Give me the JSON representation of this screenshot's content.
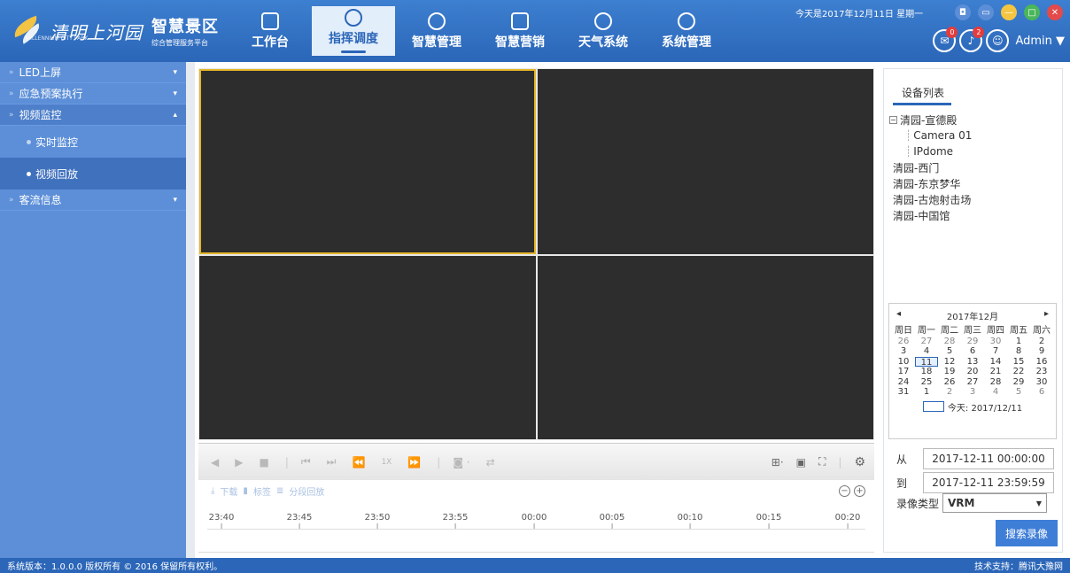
{
  "header": {
    "logo_script": "清明上河园",
    "logo_title": "智慧景区",
    "logo_subtitle": "综合管理服务平台",
    "logo_en": "MILLENNIUM CITY PARK",
    "date_line": "今天是2017年12月11日 星期一",
    "nav": [
      {
        "label": "工作台"
      },
      {
        "label": "指挥调度"
      },
      {
        "label": "智慧管理"
      },
      {
        "label": "智慧营销"
      },
      {
        "label": "天气系统"
      },
      {
        "label": "系统管理"
      }
    ],
    "badge_msg": "0",
    "badge_alert": "2",
    "username": "Admin ▼"
  },
  "sidebar": {
    "items": [
      {
        "label": "LED上屏"
      },
      {
        "label": "应急预案执行"
      },
      {
        "label": "视频监控"
      },
      {
        "label": "客流信息"
      }
    ],
    "sub": [
      {
        "label": "实时监控"
      },
      {
        "label": "视频回放"
      }
    ]
  },
  "controls": {
    "speed": "1X",
    "tool_download": "下载",
    "tool_bookmark": "标签",
    "tool_segment": "分段回放"
  },
  "timeline": {
    "ticks": [
      "23:40",
      "23:45",
      "23:50",
      "23:55",
      "00:00",
      "00:05",
      "00:10",
      "00:15",
      "00:20"
    ]
  },
  "right": {
    "tab": "设备列表",
    "tree_root": "清园-宣德殿",
    "tree_children": [
      "Camera 01",
      "IPdome"
    ],
    "tree_leaves": [
      "清园-西门",
      "清园-东京梦华",
      "清园-古炮射击场",
      "清园-中国馆"
    ],
    "calendar": {
      "title": "2017年12月",
      "weekdays": [
        "周日",
        "周一",
        "周二",
        "周三",
        "周四",
        "周五",
        "周六"
      ],
      "days": [
        "26",
        "27",
        "28",
        "29",
        "30",
        "1",
        "2",
        "3",
        "4",
        "5",
        "6",
        "7",
        "8",
        "9",
        "10",
        "11",
        "12",
        "13",
        "14",
        "15",
        "16",
        "17",
        "18",
        "19",
        "20",
        "21",
        "22",
        "23",
        "24",
        "25",
        "26",
        "27",
        "28",
        "29",
        "30",
        "31",
        "1",
        "2",
        "3",
        "4",
        "5",
        "6"
      ],
      "today": "今天: 2017/12/11"
    },
    "from_label": "从",
    "from_value": "2017-12-11 00:00:00",
    "to_label": "到",
    "to_value": "2017-12-11 23:59:59",
    "type_label": "录像类型",
    "type_value": "VRM",
    "search_label": "搜索录像"
  },
  "footer": {
    "left": "系统版本：1.0.0.0  版权所有 © 2016  保留所有权利。",
    "right": "技术支持：腾讯大豫网"
  }
}
